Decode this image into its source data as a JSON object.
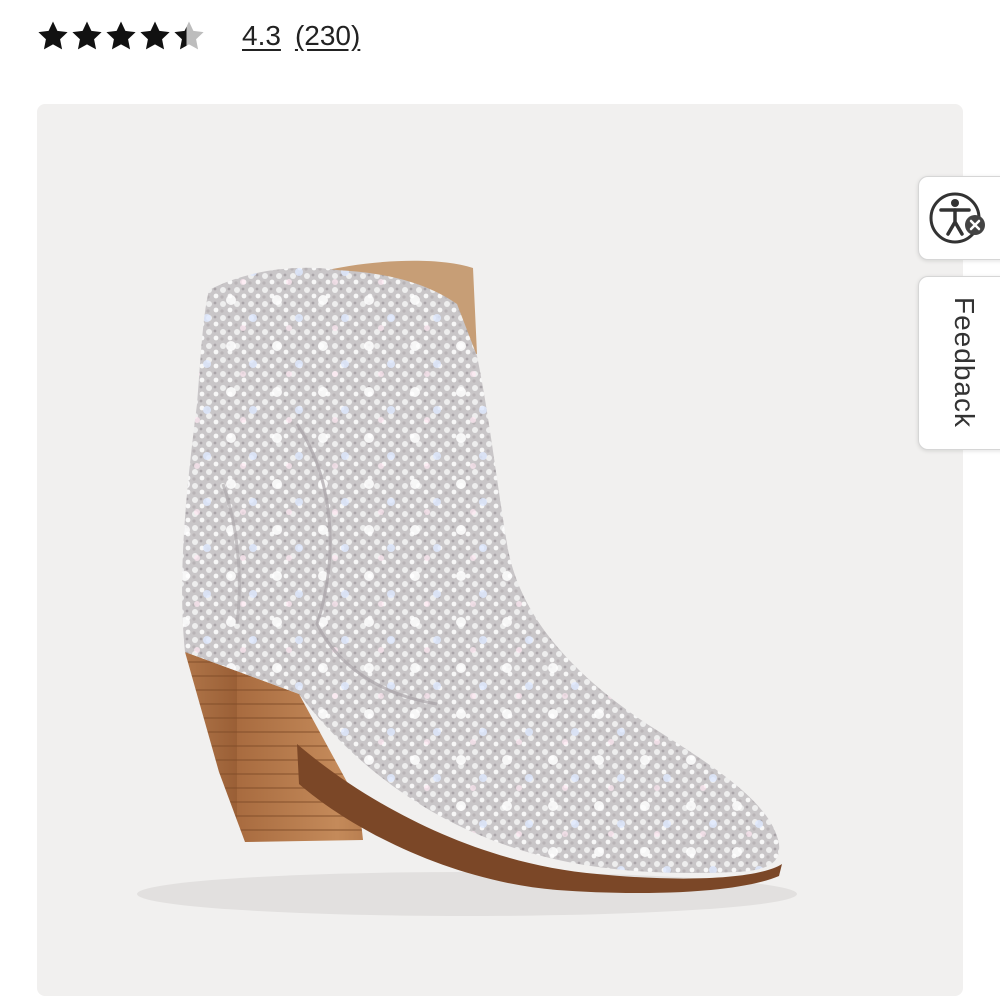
{
  "rating": {
    "value": "4.3",
    "count": "(230)",
    "stars_filled": 4.3,
    "stars_total": 5,
    "star_color": "#111111",
    "star_empty_color": "#bdbdbd"
  },
  "product": {
    "image_icon": "rhinestone-western-ankle-boot-image",
    "panel_color": "#f1f0ef"
  },
  "side_tabs": {
    "accessibility_icon": "accessibility-icon",
    "feedback_label": "Feedback"
  }
}
